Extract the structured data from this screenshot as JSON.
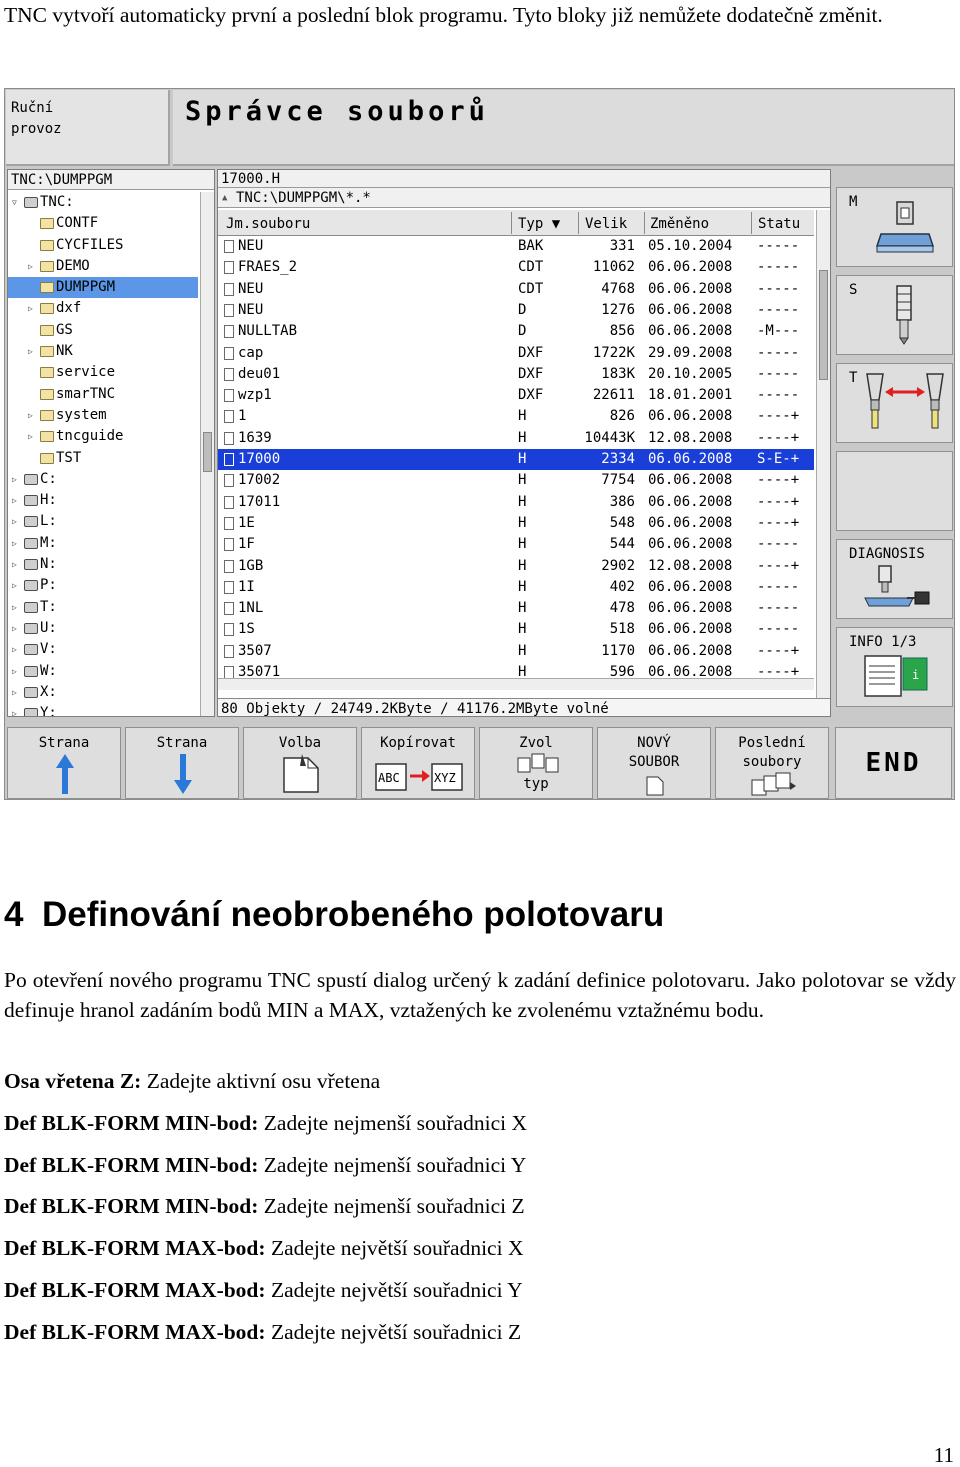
{
  "intro_text": "TNC vytvoří automaticky první a poslední blok programu. Tyto bloky již nemůžete dodatečně změnit.",
  "screen": {
    "mode_line1": "Ruční",
    "mode_line2": "provoz",
    "title": "Správce souborů",
    "tree_path": "TNC:\\DUMPPGM",
    "tree_items": [
      {
        "label": "TNC:"
      },
      {
        "label": "CONTF"
      },
      {
        "label": "CYCFILES"
      },
      {
        "label": "DEMO"
      },
      {
        "label": "DUMPPGM"
      },
      {
        "label": "dxf"
      },
      {
        "label": "GS"
      },
      {
        "label": "NK"
      },
      {
        "label": "service"
      },
      {
        "label": "smarTNC"
      },
      {
        "label": "system"
      },
      {
        "label": "tncguide"
      },
      {
        "label": "TST"
      },
      {
        "label": "C:"
      },
      {
        "label": "H:"
      },
      {
        "label": "L:"
      },
      {
        "label": "M:"
      },
      {
        "label": "N:"
      },
      {
        "label": "P:"
      },
      {
        "label": "T:"
      },
      {
        "label": "U:"
      },
      {
        "label": "V:"
      },
      {
        "label": "W:"
      },
      {
        "label": "X:"
      },
      {
        "label": "Y:"
      }
    ],
    "file_name": "17000.H",
    "file_path": "TNC:\\DUMPPGM\\*.*",
    "columns": {
      "name": "Jm.souboru",
      "type": "Typ ▼",
      "size": "Velik",
      "date": "Změněno",
      "status": "Statu"
    },
    "files": [
      {
        "name": "NEU",
        "type": "BAK",
        "size": "331",
        "date": "05.10.2004",
        "status": "-----"
      },
      {
        "name": "FRAES_2",
        "type": "CDT",
        "size": "11062",
        "date": "06.06.2008",
        "status": "-----"
      },
      {
        "name": "NEU",
        "type": "CDT",
        "size": "4768",
        "date": "06.06.2008",
        "status": "-----"
      },
      {
        "name": "NEU",
        "type": "D",
        "size": "1276",
        "date": "06.06.2008",
        "status": "-----"
      },
      {
        "name": "NULLTAB",
        "type": "D",
        "size": "856",
        "date": "06.06.2008",
        "status": "-M---"
      },
      {
        "name": "cap",
        "type": "DXF",
        "size": "1722K",
        "date": "29.09.2008",
        "status": "-----"
      },
      {
        "name": "deu01",
        "type": "DXF",
        "size": "183K",
        "date": "20.10.2005",
        "status": "-----"
      },
      {
        "name": "wzp1",
        "type": "DXF",
        "size": "22611",
        "date": "18.01.2001",
        "status": "-----"
      },
      {
        "name": "1",
        "type": "H",
        "size": "826",
        "date": "06.06.2008",
        "status": "----+"
      },
      {
        "name": "1639",
        "type": "H",
        "size": "10443K",
        "date": "12.08.2008",
        "status": "----+"
      },
      {
        "name": "17000",
        "type": "H",
        "size": "2334",
        "date": "06.06.2008",
        "status": "S-E-+"
      },
      {
        "name": "17002",
        "type": "H",
        "size": "7754",
        "date": "06.06.2008",
        "status": "----+"
      },
      {
        "name": "17011",
        "type": "H",
        "size": "386",
        "date": "06.06.2008",
        "status": "----+"
      },
      {
        "name": "1E",
        "type": "H",
        "size": "548",
        "date": "06.06.2008",
        "status": "----+"
      },
      {
        "name": "1F",
        "type": "H",
        "size": "544",
        "date": "06.06.2008",
        "status": "-----"
      },
      {
        "name": "1GB",
        "type": "H",
        "size": "2902",
        "date": "12.08.2008",
        "status": "----+"
      },
      {
        "name": "1I",
        "type": "H",
        "size": "402",
        "date": "06.06.2008",
        "status": "-----"
      },
      {
        "name": "1NL",
        "type": "H",
        "size": "478",
        "date": "06.06.2008",
        "status": "-----"
      },
      {
        "name": "1S",
        "type": "H",
        "size": "518",
        "date": "06.06.2008",
        "status": "-----"
      },
      {
        "name": "3507",
        "type": "H",
        "size": "1170",
        "date": "06.06.2008",
        "status": "----+"
      },
      {
        "name": "35071",
        "type": "H",
        "size": "596",
        "date": "06.06.2008",
        "status": "----+"
      }
    ],
    "status_bar": "80 Objekty / 24749.2KByte / 41176.2MByte volné",
    "side_buttons": {
      "m": "M",
      "s": "S",
      "t": "T",
      "diagnosis": "DIAGNOSIS",
      "info": "INFO 1/3"
    },
    "softkeys": {
      "sk1": "Strana",
      "sk2": "Strana",
      "sk3": "Volba",
      "sk4": "Kopírovat",
      "sk4_from": "ABC",
      "sk4_to": "XYZ",
      "sk5_l1": "Zvol",
      "sk5_l2": "typ",
      "sk6_l1": "NOVÝ",
      "sk6_l2": "SOUBOR",
      "sk7_l1": "Poslední",
      "sk7_l2": "soubory",
      "sk8": "END"
    }
  },
  "section": {
    "number": "4",
    "title": "Definování neobrobeného polotovaru",
    "paragraph": "Po otevření nového programu TNC spustí dialog určený k zadání definice polotovaru. Jako polotovar se vždy definuje hranol zadáním bodů MIN a MAX, vztažených ke zvolenému vztažnému bodu.",
    "items": [
      {
        "term": "Osa vřetena Z:",
        "desc": " Zadejte aktivní osu vřetena"
      },
      {
        "term": "Def BLK-FORM MIN-bod:",
        "desc": " Zadejte nejmenší souřadnici X"
      },
      {
        "term": "Def BLK-FORM MIN-bod:",
        "desc": " Zadejte nejmenší souřadnici Y"
      },
      {
        "term": "Def BLK-FORM MIN-bod:",
        "desc": " Zadejte nejmenší souřadnici Z"
      },
      {
        "term": "Def BLK-FORM MAX-bod:",
        "desc": " Zadejte největší souřadnici X"
      },
      {
        "term": "Def BLK-FORM MAX-bod:",
        "desc": " Zadejte největší souřadnici Y"
      },
      {
        "term": "Def BLK-FORM MAX-bod:",
        "desc": " Zadejte největší souřadnici Z"
      }
    ]
  },
  "page_number": "11",
  "colors": {
    "selection_row": "#1a3fd8",
    "selection_tree": "#5b97e6",
    "arrow_blue": "#2a78d8",
    "arrow_red": "#e02020"
  }
}
